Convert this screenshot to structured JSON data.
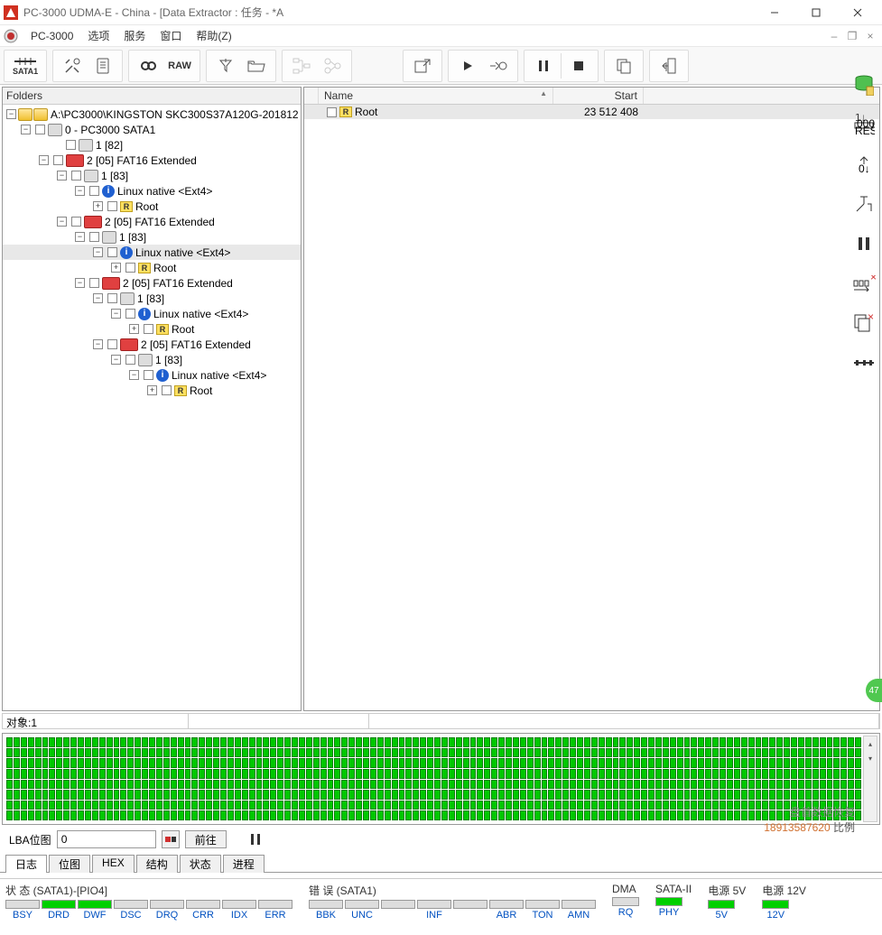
{
  "window": {
    "title": "PC-3000 UDMA-E - China - [Data Extractor : 任务 - *A",
    "app_label": "PC-3000"
  },
  "menu": {
    "items": [
      "选项",
      "服务",
      "窗口",
      "帮助(Z)"
    ]
  },
  "toolbar": {
    "sata_label": "SATA1",
    "raw_label": "RAW"
  },
  "folders": {
    "header": "Folders",
    "root": "A:\\PC3000\\KINGSTON SKC300S37A120G-201812",
    "node0": "0 - PC3000 SATA1",
    "n1_82": "1 [82]",
    "n2_05": "2 [05] FAT16 Extended",
    "n1_83": "1 [83]",
    "linux": "Linux native <Ext4>",
    "root_lbl": "Root"
  },
  "list": {
    "col_name": "Name",
    "col_start": "Start",
    "row_name": "Root",
    "row_start": "23 512 408"
  },
  "status_bar": {
    "objects": "对象:1"
  },
  "lba": {
    "label": "LBA位图",
    "value": "0",
    "go": "前往"
  },
  "tabs": [
    "日志",
    "位图",
    "HEX",
    "结构",
    "状态",
    "进程"
  ],
  "bottom": {
    "status_title": "状 态 (SATA1)-[PIO4]",
    "status_labels": [
      "BSY",
      "DRD",
      "DWF",
      "DSC",
      "DRQ",
      "CRR",
      "IDX",
      "ERR"
    ],
    "status_on": [
      false,
      true,
      true,
      false,
      false,
      false,
      false,
      false
    ],
    "error_title": "错 误 (SATA1)",
    "error_labels": [
      "BBK",
      "UNC",
      "",
      "INF",
      "",
      "ABR",
      "TON",
      "AMN"
    ],
    "error_on": [
      false,
      false,
      false,
      false,
      false,
      false,
      false,
      false
    ],
    "dma_title": "DMA",
    "dma_labels": [
      "RQ"
    ],
    "dma_on": [
      false
    ],
    "sata2_title": "SATA-II",
    "sata2_labels": [
      "PHY"
    ],
    "sata2_on": [
      true
    ],
    "pwr5_title": "电源 5V",
    "pwr5_labels": [
      "5V"
    ],
    "pwr5_on": [
      true
    ],
    "pwr12_title": "电源 12V",
    "pwr12_labels": [
      "12V"
    ],
    "pwr12_on": [
      true
    ]
  },
  "watermark": {
    "text": "盘首数据恢复",
    "phone": "18913587620"
  },
  "bubble": "47"
}
